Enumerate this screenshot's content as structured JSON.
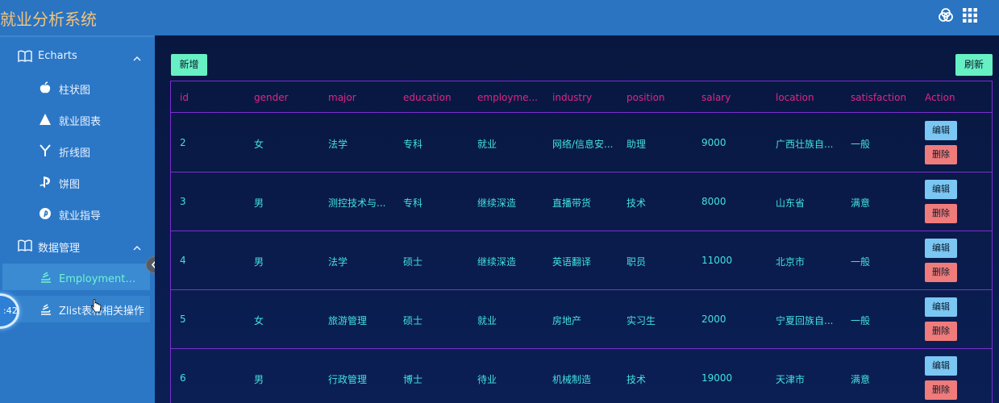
{
  "app": {
    "title": "就业分析系统"
  },
  "sidebar": {
    "groups": [
      {
        "label": "Echarts",
        "items": [
          "柱状图",
          "就业图表",
          "折线图",
          "饼图",
          "就业指导"
        ]
      },
      {
        "label": "数据管理",
        "items": [
          "Employment表相...",
          "Zlist表格相关操作"
        ]
      }
    ],
    "active_item": "Employment表相..."
  },
  "clock": {
    "text": ":42"
  },
  "toolbar": {
    "add_label": "新增",
    "refresh_label": "刷新"
  },
  "table": {
    "columns": [
      "id",
      "gender",
      "major",
      "education",
      "employme...",
      "industry",
      "position",
      "salary",
      "location",
      "satisfaction",
      "Action"
    ],
    "rows": [
      {
        "id": "2",
        "gender": "女",
        "major": "法学",
        "education": "专科",
        "employment": "就业",
        "industry": "网络/信息安...",
        "position": "助理",
        "salary": "9000",
        "location": "广西壮族自...",
        "satisfaction": "一般"
      },
      {
        "id": "3",
        "gender": "男",
        "major": "测控技术与...",
        "education": "专科",
        "employment": "继续深造",
        "industry": "直播带货",
        "position": "技术",
        "salary": "8000",
        "location": "山东省",
        "satisfaction": "满意"
      },
      {
        "id": "4",
        "gender": "男",
        "major": "法学",
        "education": "硕士",
        "employment": "继续深造",
        "industry": "英语翻译",
        "position": "职员",
        "salary": "11000",
        "location": "北京市",
        "satisfaction": "一般"
      },
      {
        "id": "5",
        "gender": "女",
        "major": "旅游管理",
        "education": "硕士",
        "employment": "就业",
        "industry": "房地产",
        "position": "实习生",
        "salary": "2000",
        "location": "宁夏回族自...",
        "satisfaction": "一般"
      },
      {
        "id": "6",
        "gender": "男",
        "major": "行政管理",
        "education": "博士",
        "employment": "待业",
        "industry": "机械制造",
        "position": "技术",
        "salary": "19000",
        "location": "天津市",
        "satisfaction": "满意"
      }
    ],
    "edit_label": "编辑",
    "delete_label": "删除"
  },
  "colors": {
    "header": "#2a74c2",
    "sidebar": "#2b77c6",
    "title_text": "#f3c37a",
    "table_header_text": "#e02587",
    "table_cell_text": "#43e1de",
    "border": "#7b2fd1",
    "primary_button": "#67f0c4",
    "edit_button": "#7bc7f3",
    "delete_button": "#f07b7b"
  },
  "icons": {
    "header": [
      "theme-circles-icon",
      "apps-grid-icon"
    ],
    "groups": [
      "book-icon",
      "book-icon"
    ],
    "items": [
      "apple-icon",
      "triangle-icon",
      "y-branch-icon",
      "playstation-icon",
      "pinterest-icon",
      "stack-icon",
      "stack-icon"
    ]
  }
}
